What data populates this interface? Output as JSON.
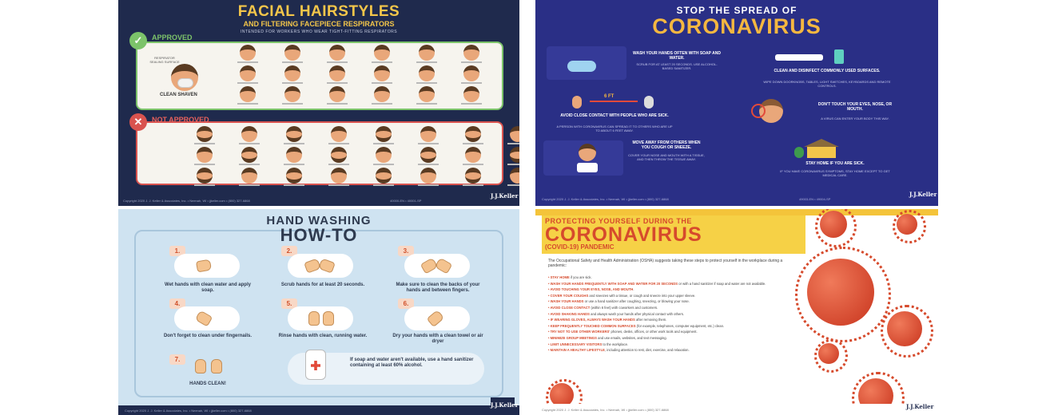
{
  "poster1": {
    "title": "FACIAL HAIRSTYLES",
    "subtitle": "AND FILTERING FACEPIECE RESPIRATORS",
    "intro": "INTENDED FOR WORKERS WHO WEAR TIGHT-FITTING RESPIRATORS",
    "approved_label": "APPROVED",
    "not_approved_label": "NOT APPROVED",
    "approved_mark": "✓",
    "not_approved_mark": "✕",
    "respirator_label": "RESPIRATOR SEALING SURFACE",
    "clean_shaven": "CLEAN SHAVEN",
    "footer": "Copyright 2020 J. J. Keller & Associates, Inc. • Neenah, WI • jjkeller.com • (800) 327-6868",
    "footer_right": "40000-EN • 40001-SP",
    "logo": "J.J.Keller"
  },
  "poster2": {
    "title1": "STOP THE SPREAD OF",
    "title2": "CORONAVIRUS",
    "tips": [
      {
        "heading": "WASH YOUR HANDS OFTEN WITH SOAP AND WATER.",
        "text": "SCRUB FOR AT LEAST 20 SECONDS. USE ALCOHOL-BASED SANITIZER."
      },
      {
        "heading": "CLEAN AND DISINFECT COMMONLY USED SURFACES.",
        "text": "WIPE DOWN DOORKNOBS, TABLES, LIGHT SWITCHES, KEYBOARDS AND REMOTE CONTROLS."
      },
      {
        "heading": "AVOID CLOSE CONTACT WITH PEOPLE WHO ARE SICK.",
        "text": "A PERSON WITH CORONAVIRUS CAN SPREAD IT TO OTHERS WHO ARE UP TO ABOUT 6 FEET AWAY."
      },
      {
        "heading": "DON'T TOUCH YOUR EYES, NOSE, OR MOUTH.",
        "text": "A VIRUS CAN ENTER YOUR BODY THIS WAY."
      },
      {
        "heading": "MOVE AWAY FROM OTHERS WHEN YOU COUGH OR SNEEZE.",
        "text": "COVER YOUR NOSE AND MOUTH WITH A TISSUE, AND THEN THROW THE TISSUE AWAY."
      },
      {
        "heading": "STAY HOME IF YOU ARE SICK.",
        "text": "IF YOU HAVE CORONAVIRUS SYMPTOMS, STAY HOME EXCEPT TO GET MEDICAL CARE."
      }
    ],
    "distance": "6 FT",
    "footer": "Copyright 2020 J. J. Keller & Associates, Inc. • Neenah, WI • jjkeller.com • (800) 327-6868",
    "footer_right": "49003-EN • 49004-SP",
    "logo": "J.J.Keller"
  },
  "poster3": {
    "title1": "HAND WASHING",
    "title2": "HOW-TO",
    "steps": [
      {
        "num": "1.",
        "text": "Wet hands with clean water and apply soap."
      },
      {
        "num": "2.",
        "text": "Scrub hands for at least 20 seconds."
      },
      {
        "num": "3.",
        "text": "Make sure to clean the backs of your hands and between fingers."
      },
      {
        "num": "4.",
        "text": "Don't forget to clean under fingernails."
      },
      {
        "num": "5.",
        "text": "Rinse hands with clean, running water."
      },
      {
        "num": "6.",
        "text": "Dry your hands with a clean towel or air dryer"
      },
      {
        "num": "7.",
        "text": "HANDS CLEAN!"
      }
    ],
    "sanitizer_text": "If soap and water aren't available, use a hand sanitizer containing at least 60% alcohol.",
    "footer": "Copyright 2020 J. J. Keller & Associates, Inc. • Neenah, WI • jjkeller.com • (800) 327-6868",
    "logo": "J.J.Keller"
  },
  "poster4": {
    "title1": "PROTECTING YOURSELF DURING THE",
    "title2": "CORONAVIRUS",
    "title3": "(COVID-19) PANDEMIC",
    "intro": "The Occupational Safety and Health Administration (OSHA) suggests taking these steps to protect yourself in the workplace during a pandemic:",
    "items": [
      {
        "bold": "STAY HOME",
        "rest": " if you are sick."
      },
      {
        "bold": "WASH YOUR HANDS FREQUENTLY WITH SOAP AND WATER FOR 20 SECONDS",
        "rest": " or with a hand sanitizer if soap and water are not available."
      },
      {
        "bold": "AVOID TOUCHING YOUR EYES, NOSE, AND MOUTH",
        "rest": "."
      },
      {
        "bold": "COVER YOUR COUGHS",
        "rest": " and sneezes with a tissue, or cough and sneeze into your upper sleeve."
      },
      {
        "bold": "WASH YOUR HANDS",
        "rest": " or use a hand sanitizer after coughing, sneezing, or blowing your nose."
      },
      {
        "bold": "AVOID CLOSE CONTACT",
        "rest": " (within 6 feet) with coworkers and customers."
      },
      {
        "bold": "AVOID SHAKING HANDS",
        "rest": " and always wash your hands after physical contact with others."
      },
      {
        "bold": "IF WEARING GLOVES, ALWAYS WASH YOUR HANDS",
        "rest": " after removing them."
      },
      {
        "bold": "KEEP FREQUENTLY TOUCHED COMMON SURFACES",
        "rest": " (for example, telephones, computer equipment, etc.) clean."
      },
      {
        "bold": "TRY NOT TO USE OTHER WORKERS'",
        "rest": " phones, desks, offices, or other work tools and equipment."
      },
      {
        "bold": "MINIMIZE GROUP MEETINGS",
        "rest": " and use emails, websites, and text messaging."
      },
      {
        "bold": "LIMIT UNNECESSARY VISITORS",
        "rest": " to the workplace."
      },
      {
        "bold": "MAINTAIN A HEALTHY LIFESTYLE",
        "rest": ", including attention to rest, diet, exercise, and relaxation."
      }
    ],
    "footer": "Copyright 2020 J. J. Keller & Associates, Inc. • Neenah, WI • jjkeller.com • (800) 327-6868",
    "logo": "J.J.Keller",
    "colors": {
      "accent": "#d64a2c",
      "banner": "#f6d146"
    }
  }
}
